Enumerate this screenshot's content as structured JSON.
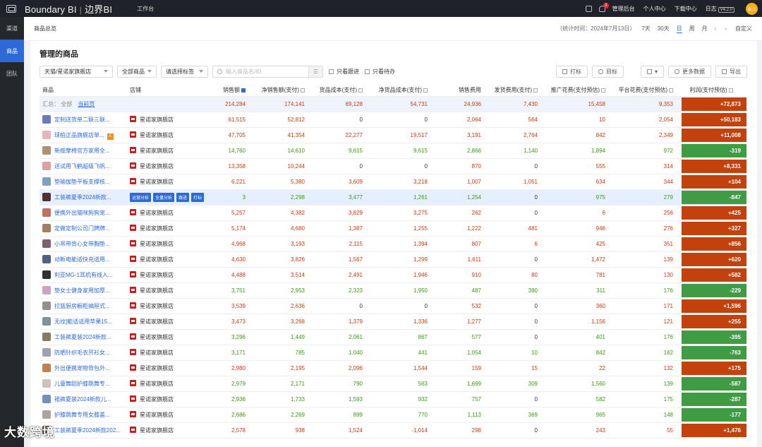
{
  "app": {
    "brand": "Boundary BI",
    "brand_cn": "边界BI",
    "workbench": "工作台"
  },
  "topnav": {
    "badge": "3",
    "items": [
      "管理后台",
      "个人中心",
      "下载中心",
      "日志"
    ],
    "version": "V4.2.0",
    "avatar": "张三"
  },
  "sidebar": {
    "items": [
      {
        "label": "渠道",
        "active": false
      },
      {
        "label": "商品",
        "active": true
      },
      {
        "label": "团队",
        "active": false
      }
    ]
  },
  "subhead": {
    "crumb": "商品总览",
    "stat_time": "（统计时间：2024年7月13日）",
    "periods": [
      {
        "label": "7天",
        "active": false
      },
      {
        "label": "30天",
        "active": false
      },
      {
        "label": "日",
        "active": true
      },
      {
        "label": "周",
        "active": false
      },
      {
        "label": "月",
        "active": false
      }
    ],
    "prev": "‹",
    "next": "›",
    "custom": "自定义"
  },
  "card": {
    "title": "管理的商品"
  },
  "filters": {
    "store": "天猫/星诺家旗舰店",
    "category": "全部商品",
    "tag": "请选择标签",
    "search_placeholder": "输入商品名/ID",
    "only_follow": "只看跟进",
    "only_pending": "只看待办"
  },
  "actions": {
    "tag": "打标",
    "target": "目标",
    "more": "更多数据",
    "export": "导出"
  },
  "columns": [
    "商品",
    "店铺",
    "销售额",
    "净销售额(支付)",
    "货品成本(支付)",
    "净货品成本(支付)",
    "销售费用",
    "发货费用(支付)",
    "推广花费(支付预估)",
    "平台花费(支付预估)",
    "利润(支付预估)"
  ],
  "summary": {
    "label": "汇总：",
    "all": "全部",
    "current": "当前页",
    "values": [
      "214,284",
      "174,141",
      "69,128",
      "54,731",
      "24,936",
      "7,430",
      "15,458",
      "9,353",
      "+72,873"
    ]
  },
  "row_buttons": [
    "运营分析",
    "全量分析",
    "跟进",
    "打标",
    "目标"
  ],
  "rows": [
    {
      "name": "定制送货单二联三联...",
      "badge": "",
      "shop": "星诺家旗舰店",
      "img": "#6b7ab8",
      "v": [
        "61,515",
        "52,812",
        "0",
        "0",
        "2,064",
        "564",
        "10",
        "2,054",
        "+50,183"
      ],
      "c": [
        "red",
        "red",
        "black",
        "black",
        "red",
        "red",
        "red",
        "red"
      ],
      "p": "pos"
    },
    {
      "name": "球拍正品旗舰店单...",
      "badge": "A",
      "shop": "星诺家旗舰店",
      "img": "#e8b4c0",
      "v": [
        "47,705",
        "41,354",
        "22,277",
        "19,517",
        "3,191",
        "2,764",
        "842",
        "2,349",
        "+11,008"
      ],
      "c": [
        "red",
        "red",
        "red",
        "red",
        "red",
        "red",
        "red",
        "red"
      ],
      "p": "pos"
    },
    {
      "name": "新按摩椅官方家用全...",
      "badge": "",
      "shop": "星诺家旗舰店",
      "img": "#b09070",
      "v": [
        "14,760",
        "14,610",
        "9,615",
        "9,615",
        "2,866",
        "1,140",
        "1,894",
        "972",
        "-319"
      ],
      "c": [
        "green",
        "green",
        "green",
        "green",
        "green",
        "green",
        "green",
        "green"
      ],
      "p": "neg"
    },
    {
      "name": "送试用飞鹤超级飞帆...",
      "badge": "",
      "shop": "星诺家旗舰店",
      "img": "#e0a0a0",
      "v": [
        "13,358",
        "10,244",
        "0",
        "0",
        "870",
        "0",
        "555",
        "314",
        "+8,331"
      ],
      "c": [
        "red",
        "red",
        "black",
        "black",
        "red",
        "black",
        "red",
        "red"
      ],
      "p": "pos"
    },
    {
      "name": "垫输伽垫平板支撑核...",
      "badge": "",
      "shop": "星诺家旗舰店",
      "img": "#7fa0c0",
      "v": [
        "6,221",
        "5,380",
        "3,609",
        "3,218",
        "1,007",
        "1,051",
        "634",
        "344",
        "+104"
      ],
      "c": [
        "red",
        "red",
        "red",
        "red",
        "red",
        "red",
        "red",
        "red"
      ],
      "p": "pos"
    },
    {
      "name": "工装裤夏季2024新款...",
      "badge": "",
      "shop": "",
      "img": "#503030",
      "v": [
        "3",
        "2,298",
        "3,477",
        "1,261",
        "1,254",
        "0",
        "975",
        "279",
        "-847"
      ],
      "c": [
        "green",
        "green",
        "green",
        "green",
        "green",
        "black",
        "green",
        "green"
      ],
      "p": "neg",
      "hl": true
    },
    {
      "name": "便携外出猫咪狗狗宠...",
      "badge": "",
      "shop": "星诺家旗舰店",
      "img": "#c07060",
      "v": [
        "5,257",
        "4,382",
        "3,829",
        "3,275",
        "262",
        "0",
        "6",
        "256",
        "+425"
      ],
      "c": [
        "red",
        "red",
        "red",
        "red",
        "red",
        "black",
        "red",
        "red"
      ],
      "p": "pos"
    },
    {
      "name": "定做定制公司门牌牌...",
      "badge": "",
      "shop": "星诺家旗舰店",
      "img": "#a08060",
      "v": [
        "5,174",
        "4,680",
        "1,387",
        "1,255",
        "1,222",
        "481",
        "946",
        "276",
        "+327"
      ],
      "c": [
        "red",
        "red",
        "red",
        "red",
        "red",
        "red",
        "red",
        "red"
      ],
      "p": "pos"
    },
    {
      "name": "小吊带背心女带胸垫...",
      "badge": "",
      "shop": "星诺家旗舰店",
      "img": "#806070",
      "v": [
        "4,968",
        "3,193",
        "2,115",
        "1,394",
        "807",
        "6",
        "425",
        "351",
        "+856"
      ],
      "c": [
        "red",
        "red",
        "red",
        "red",
        "red",
        "red",
        "red",
        "red"
      ],
      "p": "pos"
    },
    {
      "name": "动断电能适快充适用...",
      "badge": "",
      "shop": "星诺家旗舰店",
      "img": "#506080",
      "v": [
        "4,630",
        "3,826",
        "1,567",
        "1,299",
        "1,611",
        "0",
        "1,472",
        "139",
        "+620"
      ],
      "c": [
        "red",
        "red",
        "red",
        "red",
        "red",
        "black",
        "red",
        "red"
      ],
      "p": "pos"
    },
    {
      "name": "利亚MG-1耳机有线入...",
      "badge": "",
      "shop": "星诺家旗舰店",
      "img": "#303030",
      "v": [
        "4,488",
        "3,514",
        "2,491",
        "1,946",
        "910",
        "80",
        "781",
        "130",
        "+582"
      ],
      "c": [
        "red",
        "red",
        "red",
        "red",
        "red",
        "red",
        "red",
        "red"
      ],
      "p": "pos"
    },
    {
      "name": "垫女士健身家用加厚...",
      "badge": "",
      "shop": "星诺家旗舰店",
      "img": "#d0a0c0",
      "v": [
        "3,751",
        "2,953",
        "2,323",
        "1,950",
        "487",
        "380",
        "311",
        "176",
        "-229"
      ],
      "c": [
        "green",
        "green",
        "green",
        "green",
        "green",
        "green",
        "green",
        "green"
      ],
      "p": "neg"
    },
    {
      "name": "拉篮厨房橱柜抽屉式...",
      "badge": "",
      "shop": "星诺家旗舰店",
      "img": "#909090",
      "v": [
        "3,539",
        "2,636",
        "0",
        "0",
        "532",
        "0",
        "360",
        "171",
        "+1,596"
      ],
      "c": [
        "red",
        "red",
        "black",
        "black",
        "red",
        "black",
        "red",
        "red"
      ],
      "p": "pos"
    },
    {
      "name": "无纹]能适适用苹果15...",
      "badge": "",
      "shop": "星诺家旗舰店",
      "img": "#8090a0",
      "v": [
        "3,473",
        "3,268",
        "1,379",
        "1,336",
        "1,277",
        "0",
        "1,156",
        "121",
        "+255"
      ],
      "c": [
        "red",
        "red",
        "red",
        "red",
        "red",
        "black",
        "red",
        "red"
      ],
      "p": "pos"
    },
    {
      "name": "工装裤夏装2024新款...",
      "badge": "",
      "shop": "星诺家旗舰店",
      "img": "#8a7a60",
      "v": [
        "3,296",
        "1,449",
        "2,061",
        "867",
        "577",
        "0",
        "401",
        "176",
        "-395"
      ],
      "c": [
        "green",
        "green",
        "green",
        "green",
        "green",
        "black",
        "green",
        "green"
      ],
      "p": "neg"
    },
    {
      "name": "防晒针织毛衣开衫女...",
      "badge": "",
      "shop": "星诺家旗舰店",
      "img": "#a0a0b0",
      "v": [
        "3,171",
        "785",
        "1,040",
        "441",
        "1,054",
        "10",
        "842",
        "162",
        "-763"
      ],
      "c": [
        "green",
        "green",
        "green",
        "green",
        "green",
        "green",
        "green",
        "green"
      ],
      "p": "neg"
    },
    {
      "name": "外出便携宠物背包外...",
      "badge": "",
      "shop": "星诺家旗舰店",
      "img": "#c08050",
      "v": [
        "2,980",
        "2,195",
        "2,096",
        "1,544",
        "159",
        "15",
        "22",
        "132",
        "+175"
      ],
      "c": [
        "red",
        "red",
        "red",
        "red",
        "red",
        "red",
        "red",
        "red"
      ],
      "p": "pos"
    },
    {
      "name": "儿童舞蹈护膝跳舞专...",
      "badge": "",
      "shop": "星诺家旗舰店",
      "img": "#d0c0c0",
      "v": [
        "2,979",
        "2,171",
        "790",
        "563",
        "1,699",
        "309",
        "1,560",
        "139",
        "-587"
      ],
      "c": [
        "green",
        "green",
        "green",
        "green",
        "green",
        "green",
        "green",
        "green"
      ],
      "p": "neg"
    },
    {
      "name": "裙裤夏装2024新款儿...",
      "badge": "",
      "shop": "星诺家旗舰店",
      "img": "#7090c0",
      "v": [
        "2,936",
        "1,733",
        "1,593",
        "932",
        "757",
        "0",
        "582",
        "175",
        "-287"
      ],
      "c": [
        "green",
        "green",
        "green",
        "green",
        "green",
        "black",
        "green",
        "green"
      ],
      "p": "neg"
    },
    {
      "name": "护膝跳舞专用女膝盖...",
      "badge": "",
      "shop": "星诺家旗舰店",
      "img": "#b0a0a0",
      "v": [
        "2,686",
        "2,269",
        "899",
        "770",
        "1,113",
        "369",
        "965",
        "148",
        "-177"
      ],
      "c": [
        "green",
        "green",
        "green",
        "green",
        "green",
        "green",
        "green",
        "green"
      ],
      "p": "neg"
    },
    {
      "name": "工装裤夏季2024新款202...",
      "badge": "",
      "shop": "星诺家旗舰店",
      "img": "#605040",
      "v": [
        "2,578",
        "938",
        "1,524",
        "-1,014",
        "298",
        "0",
        "243",
        "55",
        "+1,476"
      ],
      "c": [
        "red",
        "red",
        "red",
        "red",
        "red",
        "black",
        "red",
        "red"
      ],
      "p": "pos"
    }
  ],
  "watermark": "大数跨境"
}
